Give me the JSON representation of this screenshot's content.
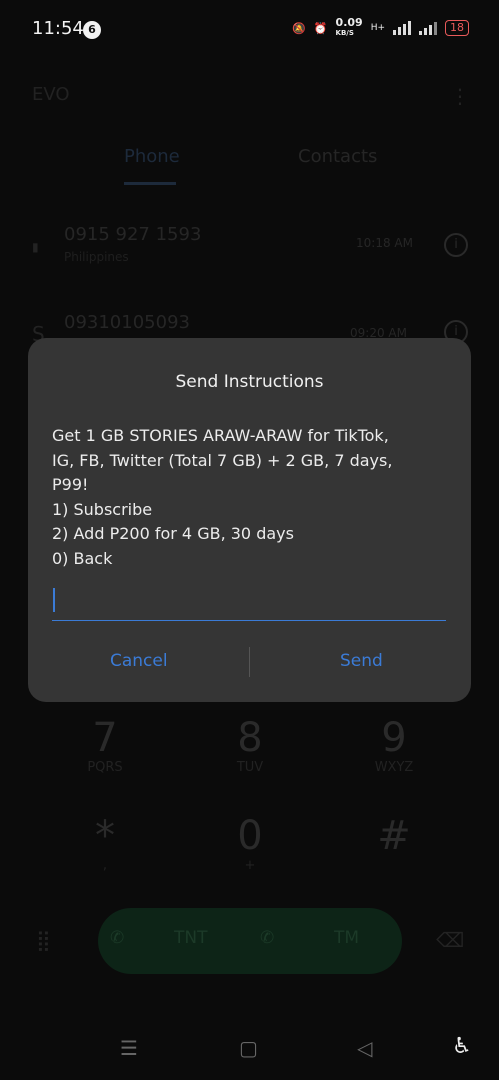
{
  "status_bar": {
    "time": "11:54",
    "notification_count": "6",
    "net_speed_value": "0.09",
    "net_speed_unit": "KB/S",
    "network_type": "H+",
    "battery": "18"
  },
  "background_app": {
    "title": "EVO",
    "tabs": [
      {
        "label": "Phone",
        "active": true
      },
      {
        "label": "Contacts",
        "active": false
      }
    ],
    "recent_calls": [
      {
        "number": "0915 927 1593",
        "sub": "Philippines",
        "time": "10:18 AM"
      },
      {
        "number": "09310105093",
        "sub": "",
        "time": "09:20 AM"
      }
    ],
    "keypad": [
      {
        "digit": "7",
        "letters": "PQRS"
      },
      {
        "digit": "8",
        "letters": "TUV"
      },
      {
        "digit": "9",
        "letters": "WXYZ"
      },
      {
        "digit": "*",
        "letters": ","
      },
      {
        "digit": "0",
        "letters": "+"
      },
      {
        "digit": "#",
        "letters": ""
      }
    ],
    "call_buttons": {
      "sim1": "TNT",
      "sim2": "TM"
    }
  },
  "dialog": {
    "title": "Send Instructions",
    "message": "Get 1 GB STORIES ARAW-ARAW for TikTok,\nIG, FB, Twitter (Total 7 GB) + 2 GB, 7 days,\nP99!\n1) Subscribe\n2) Add P200 for 4 GB, 30 days\n0) Back",
    "input_value": "",
    "cancel_label": "Cancel",
    "send_label": "Send",
    "accent_color": "#3b7bd6"
  }
}
